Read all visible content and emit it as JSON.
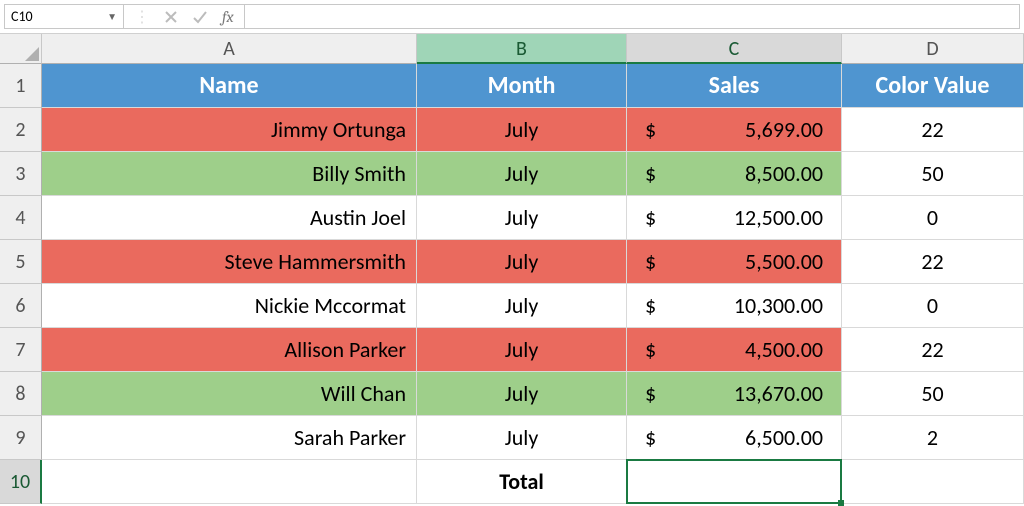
{
  "namebox": {
    "value": "C10"
  },
  "fx": {
    "label": "fx"
  },
  "columns": [
    "A",
    "B",
    "C",
    "D"
  ],
  "headers": {
    "A": "Name",
    "B": "Month",
    "C": "Sales",
    "D": "Color Value"
  },
  "rows": [
    {
      "n": "2",
      "name": "Jimmy Ortunga",
      "month": "July",
      "sales": "5,699.00",
      "cv": "22",
      "color": "red"
    },
    {
      "n": "3",
      "name": "Billy Smith",
      "month": "July",
      "sales": "8,500.00",
      "cv": "50",
      "color": "green"
    },
    {
      "n": "4",
      "name": "Austin Joel",
      "month": "July",
      "sales": "12,500.00",
      "cv": "0",
      "color": "white"
    },
    {
      "n": "5",
      "name": "Steve Hammersmith",
      "month": "July",
      "sales": "5,500.00",
      "cv": "22",
      "color": "red"
    },
    {
      "n": "6",
      "name": "Nickie Mccormat",
      "month": "July",
      "sales": "10,300.00",
      "cv": "0",
      "color": "white"
    },
    {
      "n": "7",
      "name": "Allison Parker",
      "month": "July",
      "sales": "4,500.00",
      "cv": "22",
      "color": "red"
    },
    {
      "n": "8",
      "name": "Will Chan",
      "month": "July",
      "sales": "13,670.00",
      "cv": "50",
      "color": "green"
    },
    {
      "n": "9",
      "name": "Sarah Parker",
      "month": "July",
      "sales": "6,500.00",
      "cv": "2",
      "color": "white"
    }
  ],
  "total_row": {
    "n": "10",
    "label": "Total",
    "sales": "",
    "cv": ""
  },
  "currency_symbol": "$",
  "chart_data": {
    "type": "table",
    "title": "",
    "columns": [
      "Name",
      "Month",
      "Sales",
      "Color Value"
    ],
    "data": [
      [
        "Jimmy Ortunga",
        "July",
        5699.0,
        22
      ],
      [
        "Billy Smith",
        "July",
        8500.0,
        50
      ],
      [
        "Austin Joel",
        "July",
        12500.0,
        0
      ],
      [
        "Steve Hammersmith",
        "July",
        5500.0,
        22
      ],
      [
        "Nickie Mccormat",
        "July",
        10300.0,
        0
      ],
      [
        "Allison Parker",
        "July",
        4500.0,
        22
      ],
      [
        "Will Chan",
        "July",
        13670.0,
        50
      ],
      [
        "Sarah Parker",
        "July",
        6500.0,
        2
      ]
    ]
  }
}
